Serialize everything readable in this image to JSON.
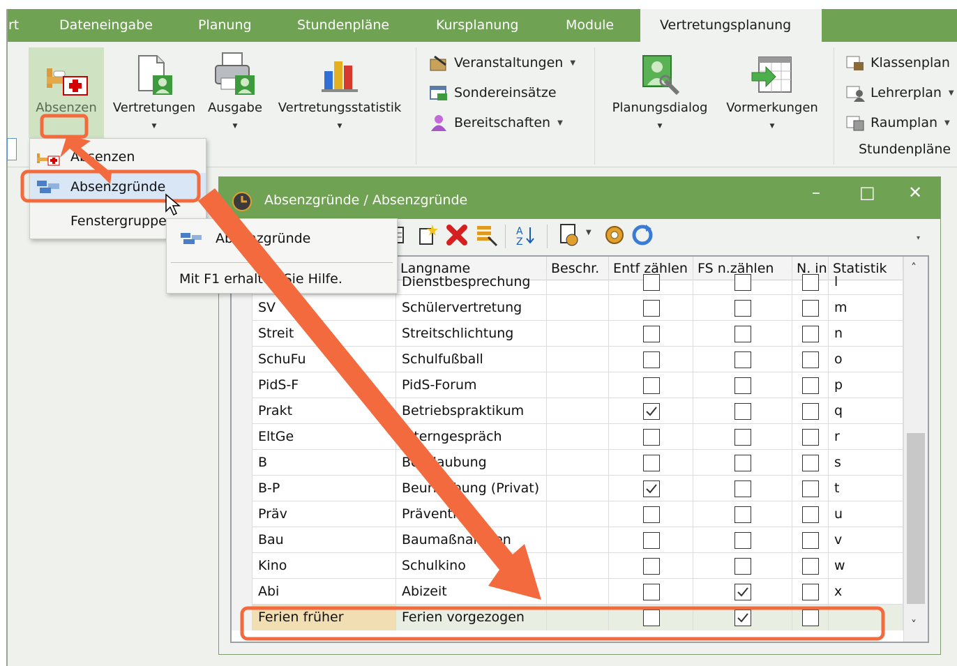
{
  "tabs": {
    "t0": "rt",
    "t1": "Dateneingabe",
    "t2": "Planung",
    "t3": "Stundenpläne",
    "t4": "Kursplanung",
    "t5": "Module",
    "t6": "Vertretungsplanung"
  },
  "ribbon": {
    "absenzen": "Absenzen",
    "vertretungen": "Vertretungen",
    "ausgabe": "Ausgabe",
    "statistik": "Vertretungsstatistik",
    "veranstaltungen": "Veranstaltungen",
    "sondereinsaetze": "Sondereinsätze",
    "bereitschaften": "Bereitschaften",
    "planungsdialog": "Planungsdialog",
    "vormerkungen": "Vormerkungen",
    "klassenplan": "Klassenplan",
    "lehrerplan": "Lehrerplan",
    "raumplan": "Raumplan",
    "stundenplaene_group": "Stundenpläne"
  },
  "menu": {
    "item1": "Absenzen",
    "item2": "Absenzgründe",
    "item3": "Fenstergruppe"
  },
  "submenu": {
    "title": "Absenzgründe",
    "help": "Mit F1 erhalten Sie Hilfe."
  },
  "window": {
    "title": "Absenzgründe / Absenzgründe",
    "minimize": "–",
    "maximize": "□",
    "close": "✕"
  },
  "table": {
    "columns": {
      "kurzname": "",
      "langname": "Langname",
      "beschr": "Beschr.",
      "entf": "Entf zählen",
      "fs": "FS n.zählen",
      "nin": "N. in",
      "statistik": "Statistik"
    },
    "rows": [
      {
        "kurz": "",
        "lang": "Dienstbesprechung",
        "entf": false,
        "fs": false,
        "nin": false,
        "stat": "l"
      },
      {
        "kurz": "SV",
        "lang": "Schülervertretung",
        "entf": false,
        "fs": false,
        "nin": false,
        "stat": "m"
      },
      {
        "kurz": "Streit",
        "lang": "Streitschlichtung",
        "entf": false,
        "fs": false,
        "nin": false,
        "stat": "n"
      },
      {
        "kurz": "SchuFu",
        "lang": "Schulfußball",
        "entf": false,
        "fs": false,
        "nin": false,
        "stat": "o"
      },
      {
        "kurz": "PidS-F",
        "lang": "PidS-Forum",
        "entf": false,
        "fs": false,
        "nin": false,
        "stat": "p"
      },
      {
        "kurz": "Prakt",
        "lang": "Betriebspraktikum",
        "entf": true,
        "fs": false,
        "nin": false,
        "stat": "q"
      },
      {
        "kurz": "EltGe",
        "lang": "Elterngespräch",
        "entf": false,
        "fs": false,
        "nin": false,
        "stat": "r"
      },
      {
        "kurz": "B",
        "lang": "Beurlaubung",
        "entf": false,
        "fs": false,
        "nin": false,
        "stat": "s"
      },
      {
        "kurz": "B-P",
        "lang": "Beurlaubung (Privat)",
        "entf": true,
        "fs": false,
        "nin": false,
        "stat": "t"
      },
      {
        "kurz": "Präv",
        "lang": "Prävention",
        "entf": false,
        "fs": false,
        "nin": false,
        "stat": "u"
      },
      {
        "kurz": "Bau",
        "lang": "Baumaßnahmen",
        "entf": false,
        "fs": false,
        "nin": false,
        "stat": "v"
      },
      {
        "kurz": "Kino",
        "lang": "Schulkino",
        "entf": false,
        "fs": false,
        "nin": false,
        "stat": "w"
      },
      {
        "kurz": "Abi",
        "lang": "Abizeit",
        "entf": false,
        "fs": true,
        "nin": false,
        "stat": "x"
      },
      {
        "kurz": "Ferien früher",
        "lang": "Ferien vorgezogen",
        "entf": false,
        "fs": true,
        "nin": false,
        "stat": ""
      }
    ]
  },
  "colors": {
    "accent_green": "#6fa353",
    "highlight_orange": "#f26a3d",
    "selected_key_cell": "#f1deb3"
  }
}
